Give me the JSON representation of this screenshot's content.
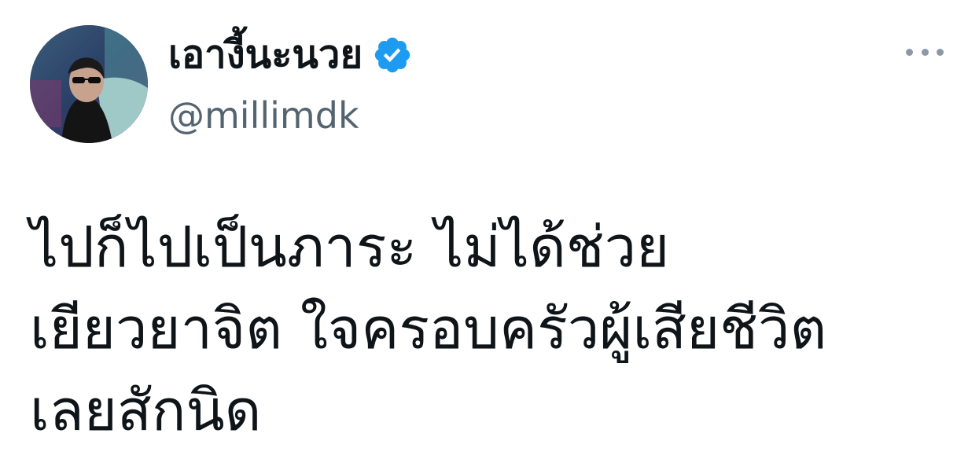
{
  "tweet": {
    "author": {
      "display_name": "เอางี้นะนวย",
      "handle": "@millimdk",
      "verified": true,
      "verified_icon": "verified-badge-icon",
      "verified_color": "#1d9bf0"
    },
    "more_icon": "more-horizontal-icon",
    "text_lines": [
      "ไปก็ไปเป็นภาระ ไม่ได้ช่วย",
      "เยียวยาจิต ใจครอบครัวผู้เสียชีวิต",
      "เลยสักนิด"
    ]
  },
  "colors": {
    "text_primary": "#0f1419",
    "text_secondary": "#536471",
    "background": "#ffffff"
  }
}
